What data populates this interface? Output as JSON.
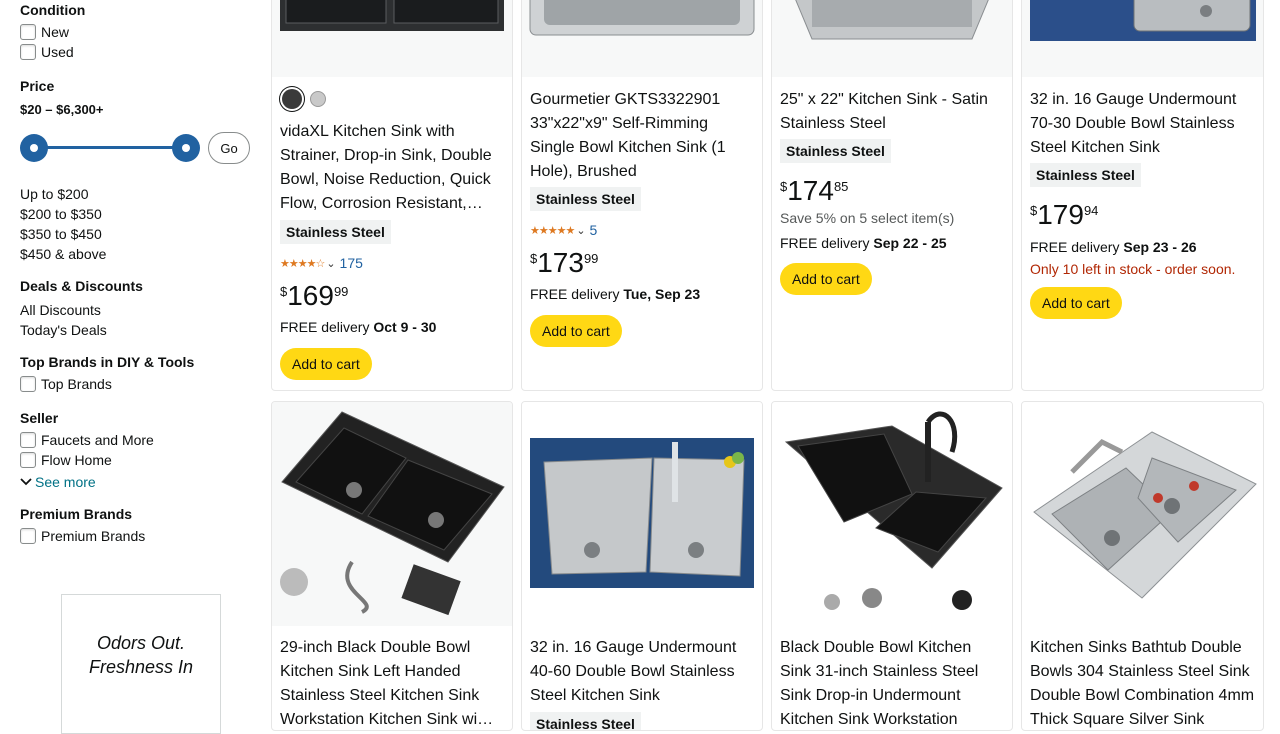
{
  "sidebar": {
    "condition": {
      "title": "Condition",
      "options": [
        "New",
        "Used"
      ]
    },
    "price": {
      "title": "Price",
      "range": "$20 – $6,300+",
      "go": "Go",
      "ranges": [
        "Up to $200",
        "$200 to $350",
        "$350 to $450",
        "$450 & above"
      ]
    },
    "deals": {
      "title": "Deals & Discounts",
      "items": [
        "All Discounts",
        "Today's Deals"
      ]
    },
    "top_brands": {
      "title": "Top Brands in DIY & Tools",
      "option": "Top Brands"
    },
    "seller": {
      "title": "Seller",
      "options": [
        "Faucets and More",
        "Flow Home"
      ],
      "see_more": "See more"
    },
    "premium": {
      "title": "Premium Brands",
      "option": "Premium Brands"
    },
    "ad": {
      "line1": "Odors Out.",
      "line2": "Freshness In"
    }
  },
  "products": [
    {
      "title": "vidaXL Kitchen Sink with Strainer, Drop-in Sink, Double Bowl, Noise Reduction, Quick Flow, Corrosion Resistant,…",
      "badge": "Stainless Steel",
      "rating_count": "175",
      "price_symbol": "$",
      "price_whole": "169",
      "price_fraction": "99",
      "delivery_prefix": "FREE delivery ",
      "delivery_date": "Oct 9 - 30",
      "cta": "Add to cart",
      "swatch_colors": [
        "#3a3a3a",
        "#c9c9c9"
      ]
    },
    {
      "title": "Gourmetier GKTS3322901 33\"x22\"x9\" Self-Rimming Single Bowl Kitchen Sink (1 Hole), Brushed",
      "badge": "Stainless Steel",
      "rating_count": "5",
      "price_symbol": "$",
      "price_whole": "173",
      "price_fraction": "99",
      "delivery_prefix": "FREE delivery ",
      "delivery_date": "Tue, Sep 23",
      "cta": "Add to cart"
    },
    {
      "title": "25\" x 22\" Kitchen Sink - Satin Stainless Steel",
      "badge": "Stainless Steel",
      "price_symbol": "$",
      "price_whole": "174",
      "price_fraction": "85",
      "save": "Save 5% on 5 select item(s)",
      "delivery_prefix": "FREE delivery ",
      "delivery_date": "Sep 22 - 25",
      "cta": "Add to cart"
    },
    {
      "title": "32 in. 16 Gauge Undermount 70-30 Double Bowl Stainless Steel Kitchen Sink",
      "badge": "Stainless Steel",
      "price_symbol": "$",
      "price_whole": "179",
      "price_fraction": "94",
      "delivery_prefix": "FREE delivery ",
      "delivery_date": "Sep 23 - 26",
      "stock": "Only 10 left in stock - order soon.",
      "cta": "Add to cart"
    },
    {
      "title": "29-inch Black Double Bowl Kitchen Sink Left Handed Stainless Steel Kitchen Sink Workstation Kitchen Sink wi…"
    },
    {
      "title": "32 in. 16 Gauge Undermount 40-60 Double Bowl Stainless Steel Kitchen Sink",
      "badge": "Stainless Steel"
    },
    {
      "title": "Black Double Bowl Kitchen Sink 31-inch Stainless Steel Sink Drop-in Undermount Kitchen Sink Workstation"
    },
    {
      "title": "Kitchen Sinks Bathtub Double Bowls 304 Stainless Steel Sink Double Bowl Combination 4mm Thick Square Silver Sink"
    }
  ],
  "colors": {
    "accent_blue": "#2162a1",
    "cart_yellow": "#ffd814",
    "star_orange": "#de7921",
    "stock_red": "#b12704"
  }
}
